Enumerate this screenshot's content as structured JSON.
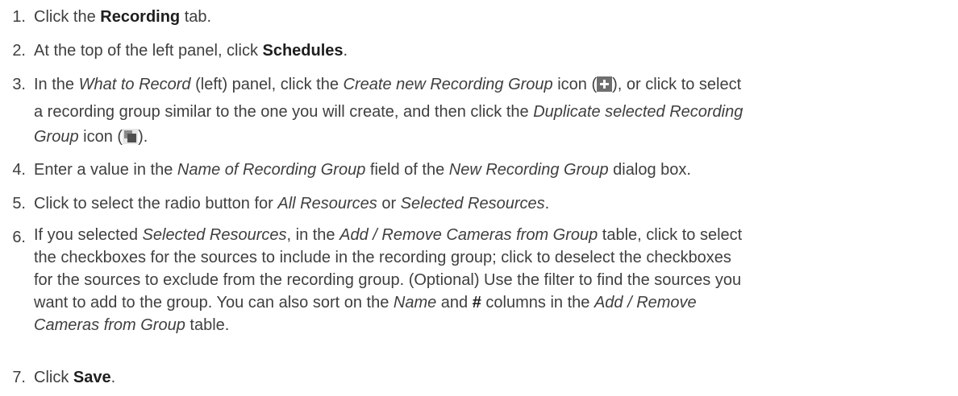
{
  "steps": [
    {
      "num": "1.",
      "t1": "Click the ",
      "b1": "Recording",
      "t2": " tab."
    },
    {
      "num": "2.",
      "t1": "At the top of the left panel, click ",
      "b1": "Schedules",
      "t2": "."
    },
    {
      "num": "3.",
      "l1_t1": "In the ",
      "l1_i1": "What to Record",
      "l1_t2": " (left) panel, click the ",
      "l1_i2": "Create new Recording Group",
      "l1_t3": " icon (",
      "l1_t4": "), or click to select",
      "l2_t1": "a recording group similar to the one you will create, and then click the ",
      "l2_i1": "Duplicate selected Recording",
      "l3_i1": "Group",
      "l3_t1": " icon (",
      "l3_t2": ").",
      "icon_create": "plus-icon",
      "icon_duplicate": "duplicate-icon"
    },
    {
      "num": "4.",
      "t1": "Enter a value in the ",
      "i1": "Name of Recording Group",
      "t2": " field of the ",
      "i2": "New Recording Group",
      "t3": " dialog box."
    },
    {
      "num": "5.",
      "t1": "Click to select the radio button for ",
      "i1": "All Resources",
      "t2": " or ",
      "i2": "Selected Resources",
      "t3": "."
    },
    {
      "num": "6.",
      "l1_t1": "If you selected ",
      "l1_i1": "Selected Resources",
      "l1_t2": ", in the ",
      "l1_i2": "Add / Remove Cameras from Group",
      "l1_t3": " table, click to select",
      "l2": "the checkboxes for the sources to include in the recording group; click to deselect the checkboxes",
      "l3": "for the sources to exclude from the recording group. (Optional) Use the filter to find the sources you",
      "l4_t1": "want to add to the group. You can also sort on the ",
      "l4_i1": "Name",
      "l4_t2": " and ",
      "l4_b1": "#",
      "l4_t3": " columns in the ",
      "l4_i2": "Add / Remove",
      "l5_i1": "Cameras from Group",
      "l5_t1": " table."
    },
    {
      "num": "7.",
      "t1": "Click ",
      "b1": "Save",
      "t2": "."
    }
  ]
}
